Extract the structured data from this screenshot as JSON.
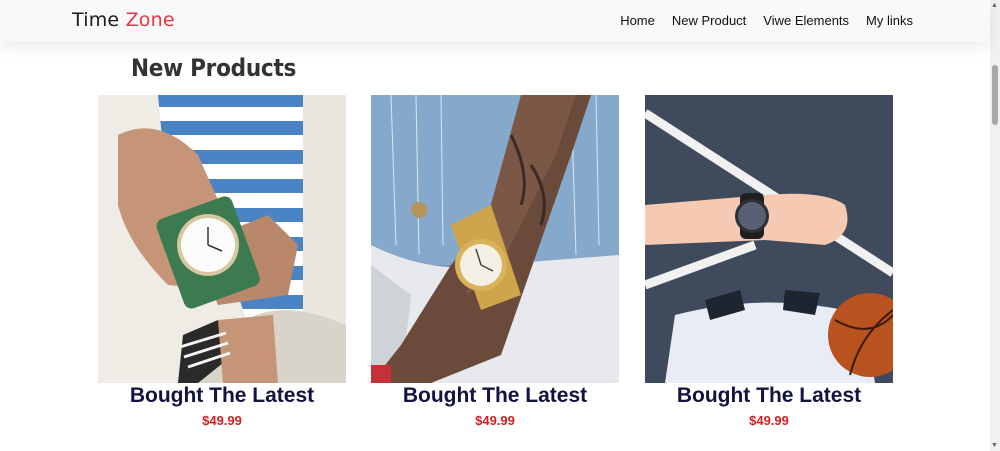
{
  "brand": {
    "name_part1": "Time",
    "name_part2": "Zone"
  },
  "nav": {
    "items": [
      "Home",
      "New Product",
      "Viwe Elements",
      "My links"
    ]
  },
  "section": {
    "title": "New Products"
  },
  "products": [
    {
      "title": "Bought The Latest",
      "price": "$49.99"
    },
    {
      "title": "Bought The Latest",
      "price": "$49.99"
    },
    {
      "title": "Bought The Latest",
      "price": "$49.99"
    }
  ],
  "colors": {
    "accent": "#e8353f",
    "price": "#d31e22",
    "product_title": "#111442"
  }
}
